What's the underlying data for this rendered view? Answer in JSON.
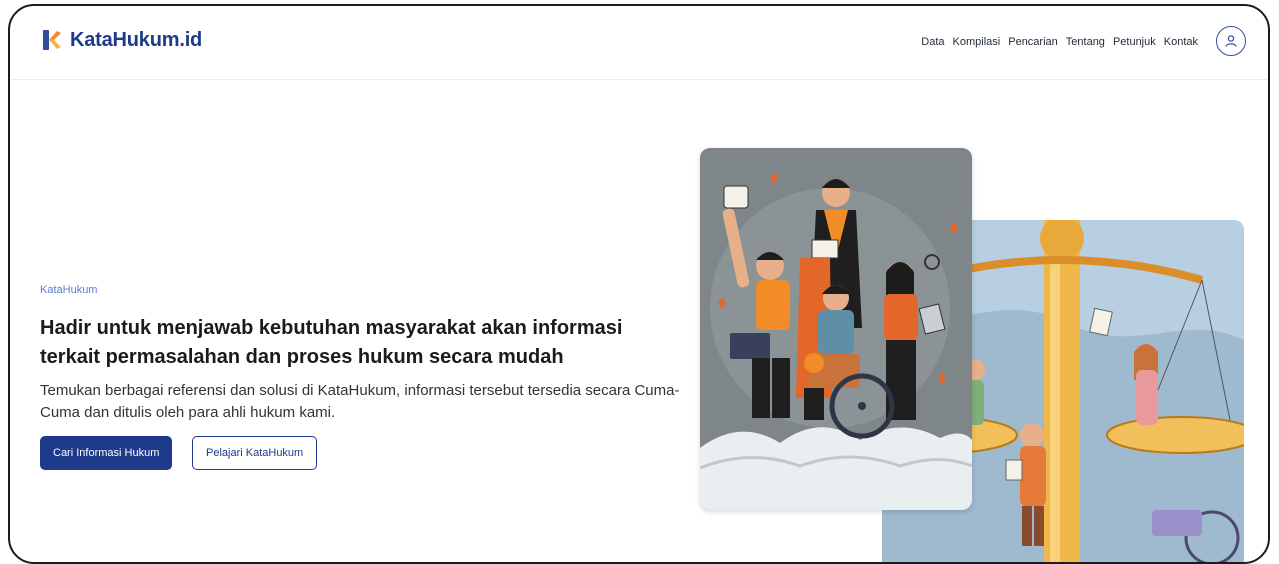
{
  "header": {
    "brand": "KataHukum.id",
    "nav": [
      "Data",
      "Kompilasi",
      "Pencarian",
      "Tentang",
      "Petunjuk",
      "Kontak"
    ]
  },
  "hero": {
    "eyebrow": "KataHukum",
    "headline": "Hadir untuk menjawab kebutuhan masyarakat akan informasi terkait permasalahan dan proses hukum secara mudah",
    "subtext": "Temukan berbagai referensi dan solusi di KataHukum, informasi tersebut tersedia secara Cuma-Cuma dan ditulis oleh para ahli hukum kami.",
    "primary_button": "Cari Informasi Hukum",
    "secondary_button": "Pelajari KataHukum"
  },
  "icons": {
    "logo": "katahukum-logo-icon",
    "profile": "user-icon"
  },
  "colors": {
    "brand": "#1e3a8a",
    "accent_orange": "#f28c28",
    "eyebrow": "#5b7bd5"
  }
}
